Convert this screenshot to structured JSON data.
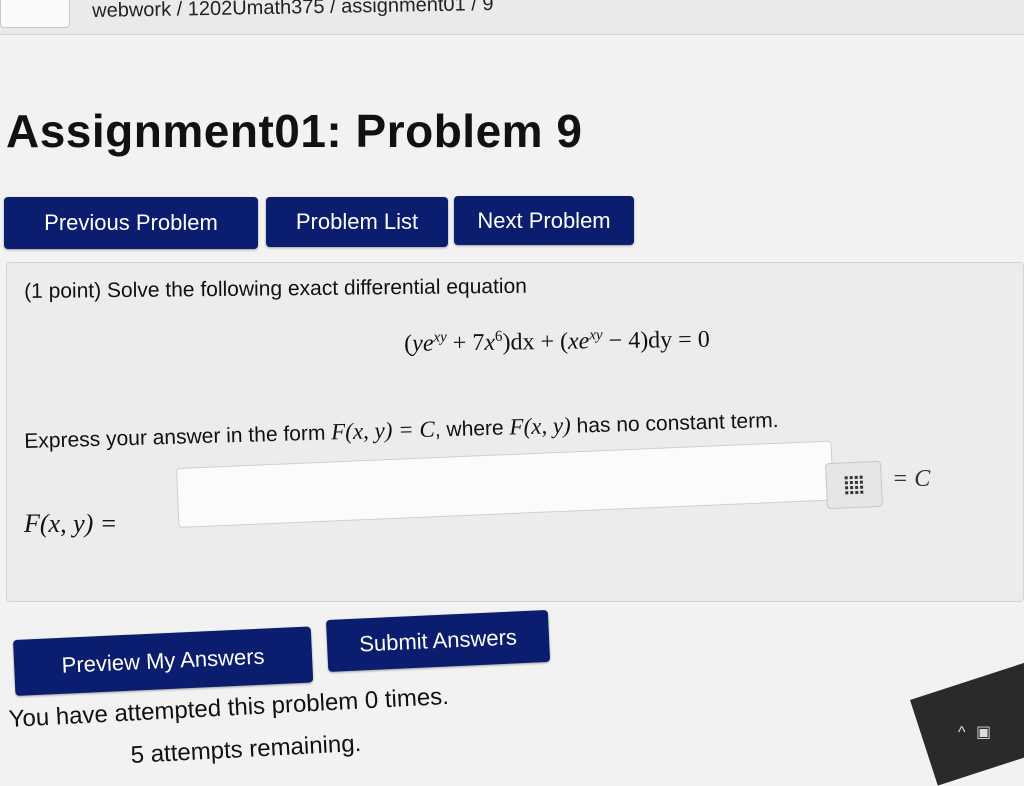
{
  "breadcrumb": "webwork / 1202Umath375 / assignment01 / 9",
  "title": "Assignment01: Problem 9",
  "nav": {
    "previous": "Previous Problem",
    "list": "Problem List",
    "next": "Next Problem"
  },
  "problem": {
    "prompt": "(1 point) Solve the following exact differential equation",
    "equation": {
      "open": "(",
      "y": "y",
      "e": "e",
      "exp1": "xy",
      "plus": "+ 7",
      "x": "x",
      "pow6": "6",
      "dx": ")dx + (",
      "xe": "xe",
      "exp2": "xy",
      "rest": "− 4)dy = 0"
    },
    "instruction_pre": "Express your answer in the form ",
    "instruction_form": "F(x, y) = C",
    "instruction_mid": ", where ",
    "instruction_fxy": "F(x, y)",
    "instruction_post": " has no constant term.",
    "answer_label": "F(x, y) =",
    "answer_value": "",
    "equals_c": "= C"
  },
  "actions": {
    "preview": "Preview My Answers",
    "submit": "Submit Answers"
  },
  "status": {
    "attempted": "You have attempted this problem 0 times.",
    "remaining": "5 attempts remaining."
  },
  "colors": {
    "button": "#0b1d6e",
    "background": "#f2f2f2"
  },
  "icons": {
    "equation_editor": "grid-icon"
  }
}
